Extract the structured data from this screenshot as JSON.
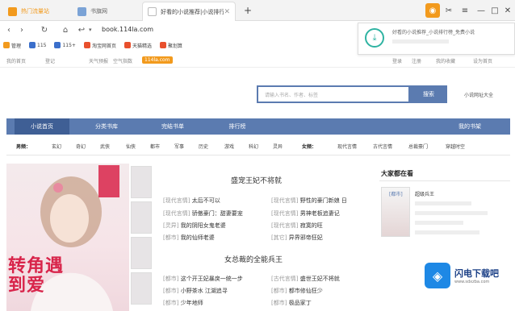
{
  "colors": {
    "accent": "#5b7bb0",
    "accent_dark": "#3f5f95",
    "brand_orange": "#f29a1d",
    "cover_red": "#d8244a",
    "download_green": "#2fb3a2"
  },
  "tabs": [
    {
      "label": "热门流量站",
      "icon": "browser-logo-icon"
    },
    {
      "label": "书旗网",
      "icon": "site-icon"
    },
    {
      "label": "好看的小说推荐|小说排行榜",
      "icon": "page-icon"
    }
  ],
  "toolbar": {
    "new_tab": "+",
    "minimize": "—",
    "maximize": "□",
    "close": "✕"
  },
  "address": {
    "url": "book.114la.com"
  },
  "bookmarks": [
    {
      "label": "管理",
      "icon": "star-icon"
    },
    {
      "label": "115",
      "icon": "cloud-icon"
    },
    {
      "label": "115+",
      "icon": "cloud-icon"
    },
    {
      "label": "淘宝网首页",
      "icon": "shop-icon"
    },
    {
      "label": "天猫精选",
      "icon": "shop-icon"
    },
    {
      "label": "聚划算",
      "icon": "shop-icon"
    }
  ],
  "popup": {
    "text": "好看的小说推荐_小说排行榜_免费小说",
    "icon": "download-icon"
  },
  "site_links": {
    "left": [
      "我的首页",
      "登记",
      "天气预报",
      "空气指数",
      "114la.com"
    ],
    "right": [
      "登录",
      "注册",
      "我的收藏",
      "设为首页"
    ]
  },
  "search": {
    "placeholder": "请输入书名、作者、标签",
    "button": "搜索",
    "link": "小说网址大全"
  },
  "main_nav": [
    "小说首页",
    "分类书库",
    "完结书单",
    "排行榜",
    "我的书架"
  ],
  "genre_row": {
    "male_label": "男频：",
    "male": [
      "玄幻",
      "奇幻",
      "武侠",
      "仙侠",
      "都市",
      "军事",
      "历史",
      "游戏",
      "科幻",
      "灵异"
    ],
    "female_label": "女频：",
    "female": [
      "现代言情",
      "古代言情",
      "总裁豪门",
      "穿越时空"
    ]
  },
  "cover": {
    "title_line1": "转角遇",
    "title_line2": "到爱"
  },
  "section1": {
    "title": "盛宠王妃不将就",
    "rows_left": [
      {
        "tag": "[现代言情]",
        "title": "太后不可以"
      },
      {
        "tag": "[现代言情]",
        "title": "骄傲豪门：甜妻要宠"
      },
      {
        "tag": "[灵异]",
        "title": "我的阴阳女鬼老婆"
      },
      {
        "tag": "[都市]",
        "title": "我的仙师老婆"
      }
    ],
    "rows_right": [
      {
        "tag": "[现代言情]",
        "title": "野性的豪门新娘 日"
      },
      {
        "tag": "[现代言情]",
        "title": "男神老板追妻记"
      },
      {
        "tag": "[现代言情]",
        "title": "寂寞的旺"
      },
      {
        "tag": "[其它]",
        "title": "异界邪帝狂妃"
      }
    ]
  },
  "section2": {
    "title": "女总裁的全能兵王",
    "rows_left": [
      {
        "tag": "[都市]",
        "title": "这个开王妃暴戾一统一步"
      },
      {
        "tag": "[都市]",
        "title": "小野茶水 江湖追寻"
      },
      {
        "tag": "[都市]",
        "title": "少年地师"
      }
    ],
    "rows_right": [
      {
        "tag": "[古代言情]",
        "title": "盛世王妃不将就"
      },
      {
        "tag": "[都市]",
        "title": "都市修仙狂少"
      },
      {
        "tag": "[都市]",
        "title": "极品家丁"
      }
    ]
  },
  "right_panel": {
    "title": "大家都在看",
    "items": [
      "[都市]",
      "超级兵王",
      "",
      "",
      ""
    ]
  },
  "watermark": {
    "cn": "闪电下载吧",
    "en": "www.sdxzba.com"
  }
}
